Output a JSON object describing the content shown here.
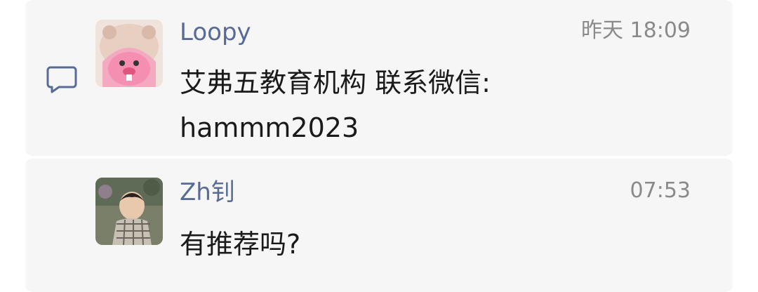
{
  "comments": [
    {
      "author": "Loopy",
      "time": "昨天 18:09",
      "text_line1": "艾弗五教育机构 联系微信:",
      "text_line2": "hammm2023",
      "avatar_icon": "pink-beaver-avatar"
    },
    {
      "author": "Zh钊",
      "time": "07:53",
      "text_line1": "有推荐吗?",
      "avatar_icon": "child-photo-avatar"
    }
  ],
  "colors": {
    "author_name": "#576b95",
    "time": "#8a8a8a",
    "text": "#1a1a1a",
    "panel_bg": "#f6f6f6",
    "icon": "#576b95"
  },
  "icons": {
    "comment": "comment-bubble-icon"
  }
}
